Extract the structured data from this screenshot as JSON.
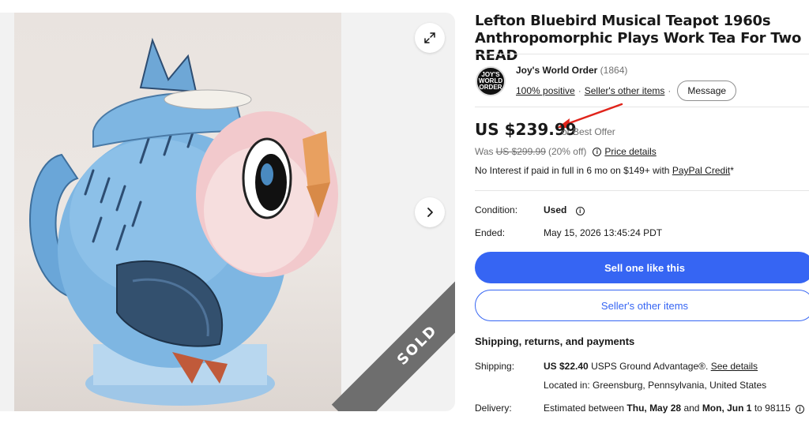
{
  "gallery": {
    "sold_label": "SOLD",
    "expand_icon": "expand-arrows-icon",
    "next_icon": "chevron-right-icon"
  },
  "listing": {
    "title": "Lefton Bluebird Musical Teapot 1960s Anthropomorphic Plays Work Tea For Two READ"
  },
  "seller": {
    "logo_text": "JOY'S WORLD ORDER",
    "name": "Joy's World Order",
    "feedback_count": "(1864)",
    "positive": "100% positive",
    "other_items": "Seller's other items",
    "message_label": "Message"
  },
  "pricing": {
    "price": "US $239.99",
    "best_offer": "or Best Offer",
    "was_label": "Was",
    "was_price": "US $299.99",
    "discount": "(20% off)",
    "price_details": "Price details",
    "interest_text": "No Interest if paid in full in 6 mo on $149+ with",
    "paypal_credit": "PayPal Credit",
    "interest_suffix": "*"
  },
  "item_info": {
    "condition_label": "Condition:",
    "condition_value": "Used",
    "ended_label": "Ended:",
    "ended_value": "May 15, 2026 13:45:24 PDT"
  },
  "actions": {
    "sell_one": "Sell one like this",
    "sellers_other_items": "Seller's other items"
  },
  "shipping": {
    "section_title": "Shipping, returns, and payments",
    "shipping_label": "Shipping:",
    "shipping_cost": "US $22.40",
    "shipping_method": "USPS Ground Advantage",
    "shipping_reg": "®.",
    "see_details": "See details",
    "located_in": "Located in: Greensburg, Pennsylvania, United States",
    "delivery_label": "Delivery:",
    "delivery_prefix": "Estimated between",
    "delivery_start": "Thu, May 28",
    "delivery_and": "and",
    "delivery_end": "Mon, Jun 1",
    "delivery_to": "to 98115"
  },
  "colors": {
    "accent": "#3665f3",
    "annotation_arrow": "#e0241b",
    "sold_ribbon": "#6e6e6e"
  }
}
